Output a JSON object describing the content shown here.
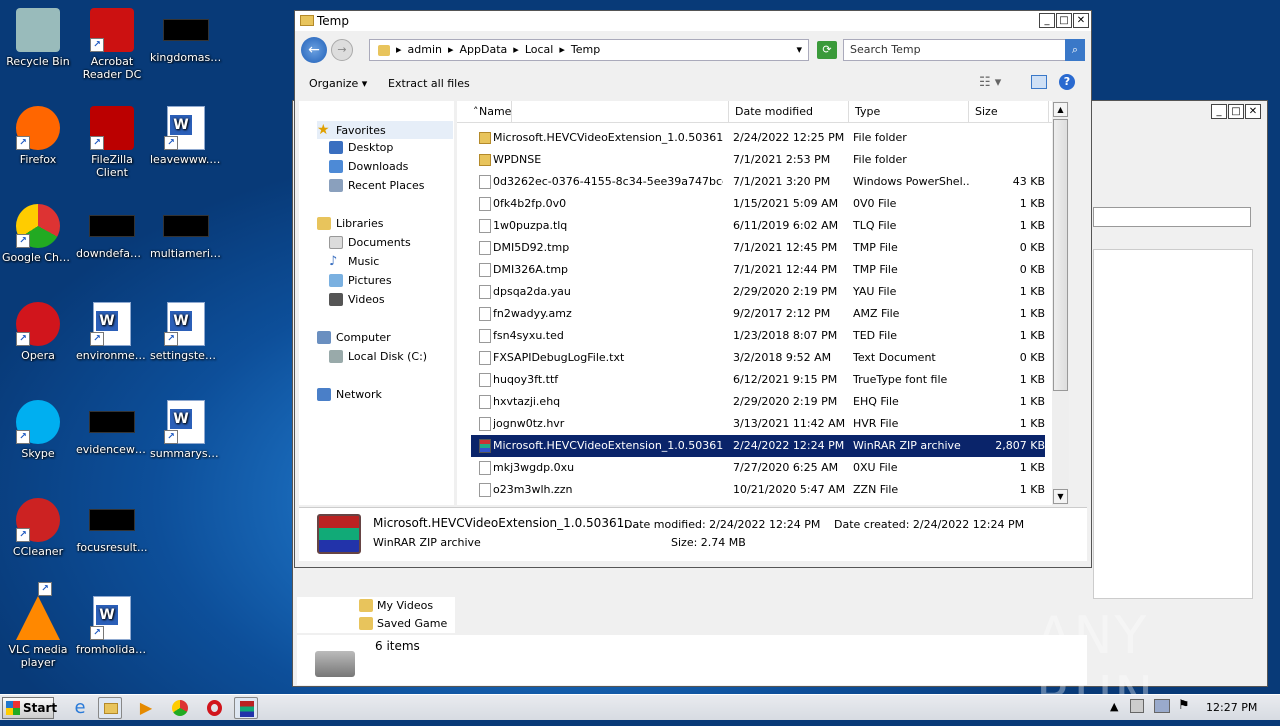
{
  "desktop_icons": [
    {
      "label": "Recycle Bin",
      "icon": "recycle-bin-icon"
    },
    {
      "label": "Acrobat Reader DC",
      "icon": "acrobat-icon"
    },
    {
      "label": "kingdomasia...",
      "icon": "blank-thumbnail"
    },
    {
      "label": "Firefox",
      "icon": "firefox-icon"
    },
    {
      "label": "FileZilla Client",
      "icon": "filezilla-icon"
    },
    {
      "label": "leavewww.rtf",
      "icon": "word-doc-icon"
    },
    {
      "label": "Google Chrome",
      "icon": "chrome-icon"
    },
    {
      "label": "downdefaul...",
      "icon": "blank-thumbnail"
    },
    {
      "label": "multiameric...",
      "icon": "blank-thumbnail"
    },
    {
      "label": "Opera",
      "icon": "opera-icon"
    },
    {
      "label": "environmen...",
      "icon": "word-doc-icon"
    },
    {
      "label": "settingstep.rtf",
      "icon": "word-doc-icon"
    },
    {
      "label": "Skype",
      "icon": "skype-icon"
    },
    {
      "label": "evidencewhi...",
      "icon": "blank-thumbnail"
    },
    {
      "label": "summarysu...",
      "icon": "word-doc-icon"
    },
    {
      "label": "CCleaner",
      "icon": "ccleaner-icon"
    },
    {
      "label": "focusresult...",
      "icon": "blank-thumbnail"
    },
    {
      "label": "VLC media player",
      "icon": "vlc-icon"
    },
    {
      "label": "fromholiday...",
      "icon": "word-doc-icon"
    }
  ],
  "explorer": {
    "title": "Temp",
    "breadcrumb": [
      "admin",
      "AppData",
      "Local",
      "Temp"
    ],
    "search_placeholder": "Search Temp",
    "toolbar": {
      "organize": "Organize",
      "extract": "Extract all files"
    },
    "tree": {
      "favorites": "Favorites",
      "desktop": "Desktop",
      "downloads": "Downloads",
      "recent": "Recent Places",
      "libraries": "Libraries",
      "documents": "Documents",
      "music": "Music",
      "pictures": "Pictures",
      "videos": "Videos",
      "computer": "Computer",
      "local_disk": "Local Disk (C:)",
      "network": "Network"
    },
    "columns": {
      "name": "Name",
      "date": "Date modified",
      "type": "Type",
      "size": "Size"
    },
    "files": [
      {
        "name": "Microsoft.HEVCVideoExtension_1.0.50361.0...",
        "date": "2/24/2022 12:25 PM",
        "type": "File folder",
        "size": "",
        "kind": "folder"
      },
      {
        "name": "WPDNSE",
        "date": "7/1/2021 2:53 PM",
        "type": "File folder",
        "size": "",
        "kind": "folder"
      },
      {
        "name": "0d3262ec-0376-4155-8c34-5ee39a747bce.ps1",
        "date": "7/1/2021 3:20 PM",
        "type": "Windows PowerShel...",
        "size": "43 KB",
        "kind": "file"
      },
      {
        "name": "0fk4b2fp.0v0",
        "date": "1/15/2021 5:09 AM",
        "type": "0V0 File",
        "size": "1 KB",
        "kind": "file"
      },
      {
        "name": "1w0puzpa.tlq",
        "date": "6/11/2019 6:02 AM",
        "type": "TLQ File",
        "size": "1 KB",
        "kind": "file"
      },
      {
        "name": "DMI5D92.tmp",
        "date": "7/1/2021 12:45 PM",
        "type": "TMP File",
        "size": "0 KB",
        "kind": "file"
      },
      {
        "name": "DMI326A.tmp",
        "date": "7/1/2021 12:44 PM",
        "type": "TMP File",
        "size": "0 KB",
        "kind": "file"
      },
      {
        "name": "dpsqa2da.yau",
        "date": "2/29/2020 2:19 PM",
        "type": "YAU File",
        "size": "1 KB",
        "kind": "file"
      },
      {
        "name": "fn2wadyy.amz",
        "date": "9/2/2017 2:12 PM",
        "type": "AMZ File",
        "size": "1 KB",
        "kind": "file"
      },
      {
        "name": "fsn4syxu.ted",
        "date": "1/23/2018 8:07 PM",
        "type": "TED File",
        "size": "1 KB",
        "kind": "file"
      },
      {
        "name": "FXSAPIDebugLogFile.txt",
        "date": "3/2/2018 9:52 AM",
        "type": "Text Document",
        "size": "0 KB",
        "kind": "file"
      },
      {
        "name": "huqoy3ft.ttf",
        "date": "6/12/2021 9:15 PM",
        "type": "TrueType font file",
        "size": "1 KB",
        "kind": "file"
      },
      {
        "name": "hxvtazji.ehq",
        "date": "2/29/2020 2:19 PM",
        "type": "EHQ File",
        "size": "1 KB",
        "kind": "file"
      },
      {
        "name": "jognw0tz.hvr",
        "date": "3/13/2021 11:42 AM",
        "type": "HVR File",
        "size": "1 KB",
        "kind": "file"
      },
      {
        "name": "Microsoft.HEVCVideoExtension_1.0.50361.0...",
        "date": "2/24/2022 12:24 PM",
        "type": "WinRAR ZIP archive",
        "size": "2,807 KB",
        "kind": "rar",
        "selected": true
      },
      {
        "name": "mkj3wgdp.0xu",
        "date": "7/27/2020 6:25 AM",
        "type": "0XU File",
        "size": "1 KB",
        "kind": "file"
      },
      {
        "name": "o23m3wlh.zzn",
        "date": "10/21/2020 5:47 AM",
        "type": "ZZN File",
        "size": "1 KB",
        "kind": "file"
      }
    ],
    "details": {
      "name": "Microsoft.HEVCVideoExtension_1.0.50361....",
      "date_modified": "Date modified: 2/24/2022 12:24 PM",
      "date_created": "Date created: 2/24/2022 12:24 PM",
      "type": "WinRAR ZIP archive",
      "size": "Size: 2.74 MB"
    }
  },
  "back_window": {
    "tree_items": [
      "My Videos",
      "Saved Game"
    ],
    "status": "6 items"
  },
  "taskbar": {
    "start": "Start",
    "clock": "12:27 PM"
  },
  "watermark": "ANY RUN"
}
